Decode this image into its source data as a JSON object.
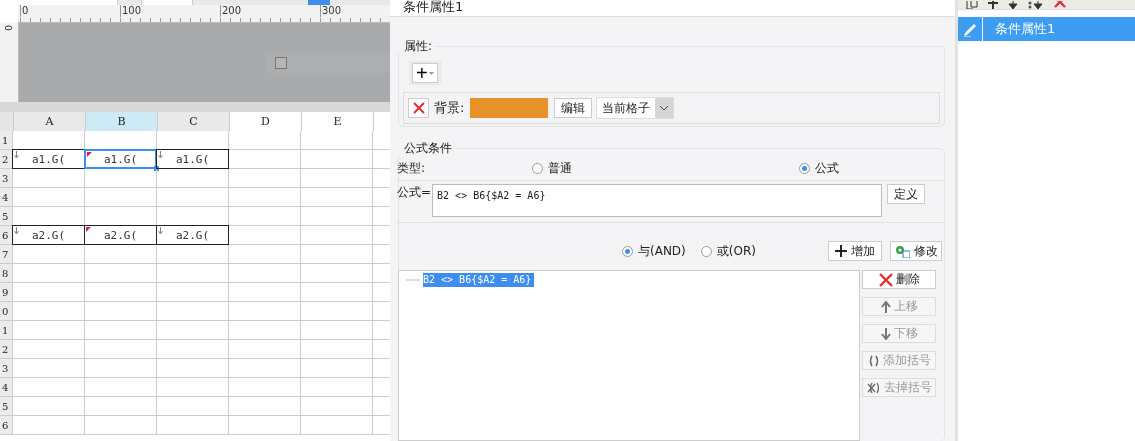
{
  "ruler": {
    "ticks": [
      "0",
      "100",
      "200",
      "300"
    ],
    "side_ticks": [
      "0"
    ]
  },
  "sheet": {
    "columns": [
      {
        "label": "A",
        "selected": false
      },
      {
        "label": "B",
        "selected": true
      },
      {
        "label": "C",
        "selected": false
      },
      {
        "label": "D",
        "selected": false
      },
      {
        "label": "E",
        "selected": false
      }
    ],
    "rows": [
      {
        "label": "1"
      },
      {
        "label": "2",
        "cells": [
          {
            "text": "a1.G(",
            "selected": false,
            "kind": "arrow"
          },
          {
            "text": "a1.G(",
            "selected": true,
            "kind": "flag"
          },
          {
            "text": "a1.G(",
            "selected": false,
            "kind": "arrow"
          }
        ]
      },
      {
        "label": "3"
      },
      {
        "label": "4"
      },
      {
        "label": "5"
      },
      {
        "label": "6",
        "cells": [
          {
            "text": "a2.G(",
            "selected": false,
            "kind": "arrow"
          },
          {
            "text": "a2.G(",
            "selected": false,
            "kind": "flag"
          },
          {
            "text": "a2.G(",
            "selected": false,
            "kind": "arrow"
          }
        ]
      },
      {
        "label": "7"
      },
      {
        "label": "8"
      },
      {
        "label": "9"
      },
      {
        "label": "0"
      },
      {
        "label": "1"
      },
      {
        "label": "2"
      },
      {
        "label": "3"
      },
      {
        "label": "4"
      },
      {
        "label": "5"
      },
      {
        "label": "6"
      }
    ]
  },
  "dialog": {
    "title": "条件属性1",
    "properties": {
      "legend": "属性:",
      "add_button": "+",
      "items": [
        {
          "label": "背景:",
          "color": "#e8932a",
          "edit_button": "编辑",
          "scope": "当前格子"
        }
      ]
    },
    "formula_condition": {
      "legend": "公式条件",
      "type_label": "类型:",
      "types": [
        {
          "label": "普通",
          "selected": false
        },
        {
          "label": "公式",
          "selected": true
        }
      ],
      "formula_label": "公式=",
      "formula": "B2 <> B6{$A2 = A6}",
      "define_button": "定义",
      "joins": [
        {
          "label": "与(AND)",
          "selected": true
        },
        {
          "label": "或(OR)",
          "selected": false
        }
      ],
      "add_button": "增加",
      "modify_button": "修改",
      "conditions": [
        {
          "text": "B2 <> B6{$A2 = A6}",
          "selected": true
        }
      ],
      "side_buttons": [
        {
          "kind": "delete",
          "label": "删除",
          "disabled": false
        },
        {
          "kind": "up",
          "label": "上移",
          "disabled": true
        },
        {
          "kind": "down",
          "label": "下移",
          "disabled": true
        },
        {
          "kind": "add-paren",
          "label": "添加括号",
          "disabled": true
        },
        {
          "kind": "remove-paren",
          "label": "去掉括号",
          "disabled": true
        }
      ]
    }
  },
  "condition_list": {
    "items": [
      {
        "label": "条件属性1",
        "selected": true
      }
    ]
  }
}
